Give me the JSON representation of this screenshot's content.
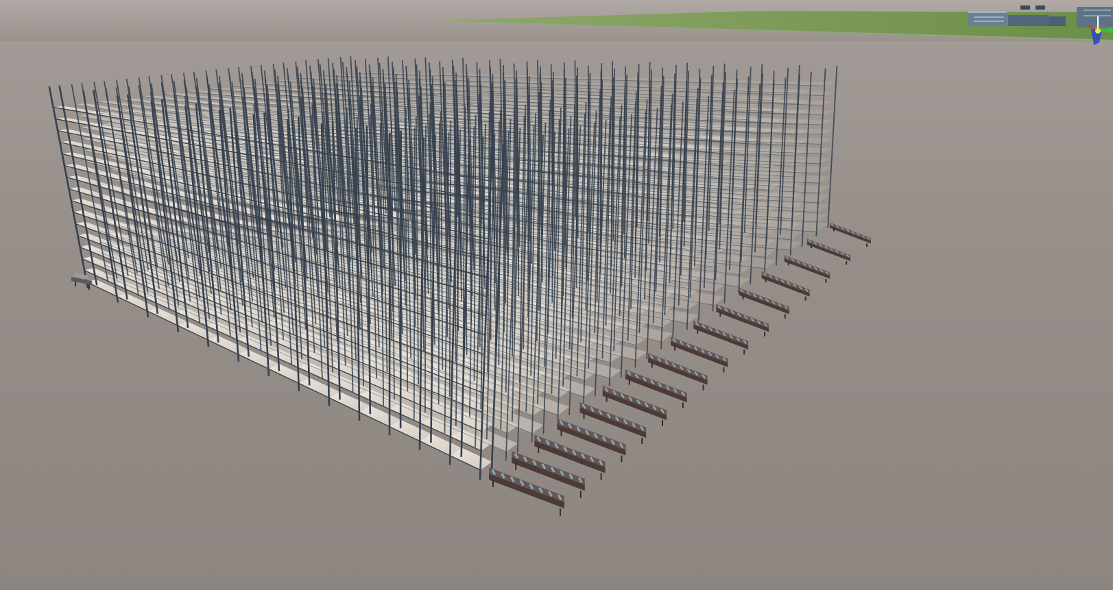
{
  "window": {
    "type": "3d-viewport",
    "content": "warehouse-rack-scene"
  },
  "colors": {
    "ground": "#8e8782",
    "sky_haze": "#a39c98",
    "grass": "#7a9a52",
    "rack_post": "#36414e",
    "rack_beam": "#2f3a46",
    "shelf": "#e7e1d8",
    "conveyor_frame": "#4b3a36",
    "conveyor_roller": "#7ea9c4",
    "building": "#5e7488",
    "gizmo_x": "#d23a2e",
    "gizmo_y": "#f4e23a",
    "gizmo_z": "#2a49c9",
    "gizmo_green": "#35c24a"
  },
  "scene": {
    "rack_aisles": 14,
    "shelf_levels": 16,
    "conveyors": 16
  },
  "gizmo": {
    "icon": "axis-gizmo-icon"
  }
}
